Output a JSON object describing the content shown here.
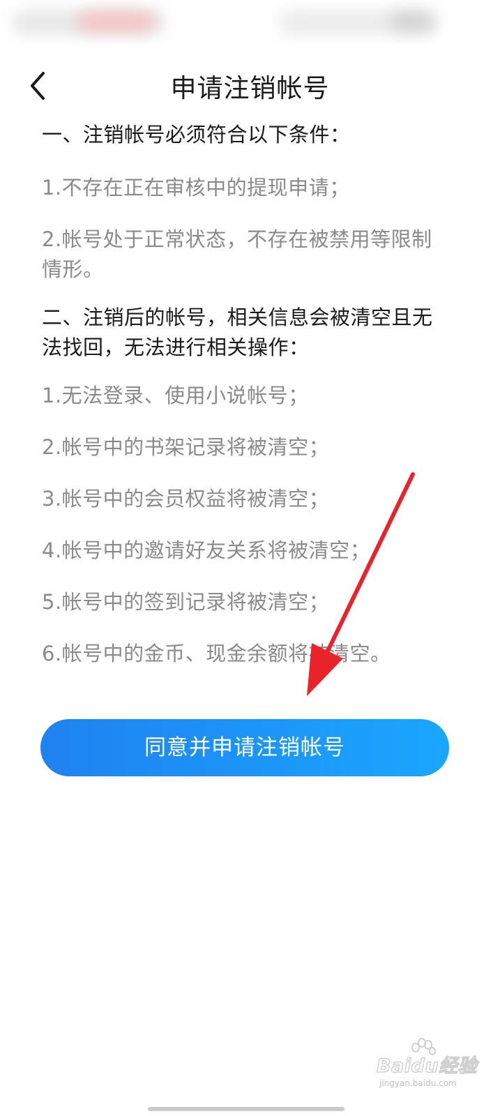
{
  "header": {
    "title": "申请注销帐号",
    "back_icon": "chevron-left-icon"
  },
  "content": {
    "section1_heading": "一、注销帐号必须符合以下条件：",
    "section1_items": [
      "1.不存在正在审核中的提现申请；",
      "2.帐号处于正常状态，不存在被禁用等限制情形。"
    ],
    "section2_heading": "二、注销后的帐号，相关信息会被清空且无法找回，无法进行相关操作：",
    "section2_items": [
      "1.无法登录、使用小说帐号；",
      "2.帐号中的书架记录将被清空；",
      "3.帐号中的会员权益将被清空；",
      "4.帐号中的邀请好友关系将被清空；",
      "5.帐号中的签到记录将被清空；",
      "6.帐号中的金币、现金余额将被清空。"
    ]
  },
  "action": {
    "agree_button_label": "同意并申请注销帐号"
  },
  "annotation": {
    "arrow_color": "#e8232a"
  },
  "watermark": {
    "brand_text": "Baidu经验",
    "url_text": "jingyan.baidu.com"
  },
  "colors": {
    "accent_start": "#1f82f0",
    "accent_end": "#1aa6ff",
    "heading_text": "#1a1a1a",
    "item_text": "#8a8a8a"
  }
}
